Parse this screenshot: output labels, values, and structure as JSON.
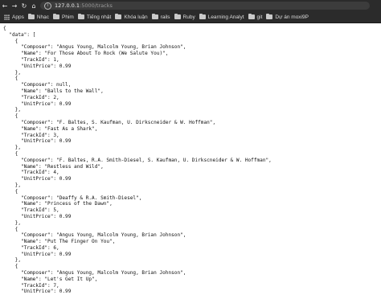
{
  "browser": {
    "url_host": "127.0.0.1",
    "url_rest": ":5000/tracks"
  },
  "bookmarks": [
    {
      "label": "Apps",
      "icon": "apps-icon"
    },
    {
      "label": "Nhạc",
      "icon": "folder-icon"
    },
    {
      "label": "Phim",
      "icon": "folder-icon"
    },
    {
      "label": "Tiếng nhật",
      "icon": "folder-icon"
    },
    {
      "label": "Khóa luận",
      "icon": "folder-icon"
    },
    {
      "label": "rails",
      "icon": "folder-icon"
    },
    {
      "label": "Ruby",
      "icon": "folder-icon"
    },
    {
      "label": "Learning Analyt",
      "icon": "folder-icon"
    },
    {
      "label": "git",
      "icon": "folder-icon"
    },
    {
      "label": "Dự án moxi9P",
      "icon": "folder-icon"
    }
  ],
  "json_lines": [
    "{",
    "  \"data\": [",
    "    {",
    "      \"Composer\": \"Angus Young, Malcolm Young, Brian Johnson\",",
    "      \"Name\": \"For Those About To Rock (We Salute You)\",",
    "      \"TrackId\": 1,",
    "      \"UnitPrice\": 0.99",
    "    },",
    "    {",
    "      \"Composer\": null,",
    "      \"Name\": \"Balls to the Wall\",",
    "      \"TrackId\": 2,",
    "      \"UnitPrice\": 0.99",
    "    },",
    "    {",
    "      \"Composer\": \"F. Baltes, S. Kaufman, U. Dirkscneider & W. Hoffman\",",
    "      \"Name\": \"Fast As a Shark\",",
    "      \"TrackId\": 3,",
    "      \"UnitPrice\": 0.99",
    "    },",
    "    {",
    "      \"Composer\": \"F. Baltes, R.A. Smith-Diesel, S. Kaufman, U. Dirkscneider & W. Hoffman\",",
    "      \"Name\": \"Restless and Wild\",",
    "      \"TrackId\": 4,",
    "      \"UnitPrice\": 0.99",
    "    },",
    "    {",
    "      \"Composer\": \"Deaffy & R.A. Smith-Diesel\",",
    "      \"Name\": \"Princess of the Dawn\",",
    "      \"TrackId\": 5,",
    "      \"UnitPrice\": 0.99",
    "    },",
    "    {",
    "      \"Composer\": \"Angus Young, Malcolm Young, Brian Johnson\",",
    "      \"Name\": \"Put The Finger On You\",",
    "      \"TrackId\": 6,",
    "      \"UnitPrice\": 0.99",
    "    },",
    "    {",
    "      \"Composer\": \"Angus Young, Malcolm Young, Brian Johnson\",",
    "      \"Name\": \"Let's Get It Up\",",
    "      \"TrackId\": 7,",
    "      \"UnitPrice\": 0.99"
  ]
}
